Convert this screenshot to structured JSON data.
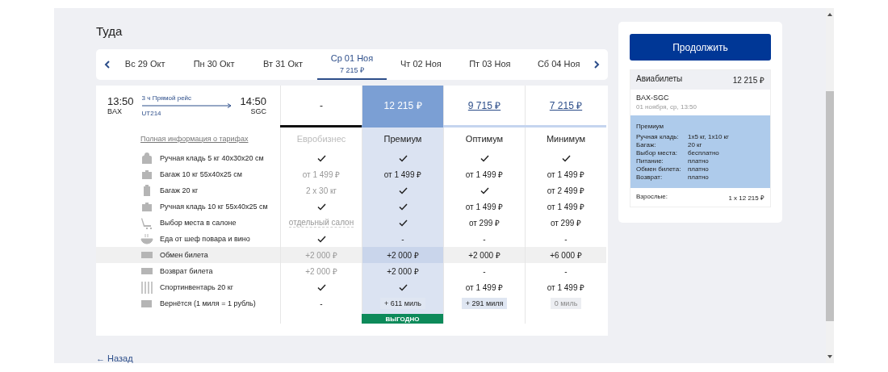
{
  "direction_title": "Туда",
  "dates": [
    {
      "label": "Вс 29 Окт",
      "selected": false
    },
    {
      "label": "Пн 30 Окт",
      "selected": false
    },
    {
      "label": "Вт 31 Окт",
      "selected": false
    },
    {
      "label": "Ср 01 Ноя",
      "price": "7 215 ₽",
      "selected": true
    },
    {
      "label": "Чт 02 Ноя",
      "selected": false
    },
    {
      "label": "Пт 03 Ноя",
      "selected": false
    },
    {
      "label": "Сб 04 Ноя",
      "selected": false
    }
  ],
  "flight": {
    "depart_time": "13:50",
    "depart_airport": "BAX",
    "duration": "3 ч",
    "flight_type": "Прямой рейс",
    "flight_number": "UT214",
    "arrive_time": "14:50",
    "arrive_airport": "SGC"
  },
  "fare_info_link": "Полная информация о тарифах",
  "tariffs": [
    {
      "name": "Евробизнес",
      "price": "-",
      "available": false,
      "selected": false
    },
    {
      "name": "Премиум",
      "price": "12 215 ₽",
      "available": true,
      "selected": true
    },
    {
      "name": "Оптимум",
      "price": "9 715 ₽",
      "available": true,
      "selected": false
    },
    {
      "name": "Минимум",
      "price": "7 215 ₽",
      "available": true,
      "selected": false
    }
  ],
  "features": [
    {
      "label": "Ручная кладь 5 кг 40x30x20 см",
      "highlighted": false,
      "values": [
        {
          "kind": "check"
        },
        {
          "kind": "check"
        },
        {
          "kind": "check"
        },
        {
          "kind": "check"
        }
      ]
    },
    {
      "label": "Багаж 10 кг 55x40x25 см",
      "highlighted": false,
      "values": [
        {
          "kind": "text",
          "text": "от 1 499 ₽",
          "muted": true
        },
        {
          "kind": "text",
          "text": "от 1 499 ₽",
          "muted": false
        },
        {
          "kind": "text",
          "text": "от 1 499 ₽",
          "muted": false
        },
        {
          "kind": "text",
          "text": "от 1 499 ₽",
          "muted": false
        }
      ]
    },
    {
      "label": "Багаж 20 кг",
      "highlighted": false,
      "values": [
        {
          "kind": "text",
          "text": "2 x 30 кг",
          "muted": true
        },
        {
          "kind": "check"
        },
        {
          "kind": "check"
        },
        {
          "kind": "text",
          "text": "от 2 499 ₽",
          "muted": false
        }
      ]
    },
    {
      "label": "Ручная кладь 10 кг 55x40x25 см",
      "highlighted": false,
      "values": [
        {
          "kind": "check"
        },
        {
          "kind": "check"
        },
        {
          "kind": "text",
          "text": "от 1 499 ₽",
          "muted": false
        },
        {
          "kind": "text",
          "text": "от 1 499 ₽",
          "muted": false
        }
      ]
    },
    {
      "label": "Выбор места в салоне",
      "highlighted": false,
      "values": [
        {
          "kind": "link",
          "text": "отдельный салон",
          "muted": true
        },
        {
          "kind": "check"
        },
        {
          "kind": "text",
          "text": "от 299 ₽",
          "muted": false
        },
        {
          "kind": "text",
          "text": "от 299 ₽",
          "muted": false
        }
      ]
    },
    {
      "label": "Еда от шеф повара и вино",
      "highlighted": false,
      "values": [
        {
          "kind": "check"
        },
        {
          "kind": "text",
          "text": "-",
          "muted": false
        },
        {
          "kind": "text",
          "text": "-",
          "muted": false
        },
        {
          "kind": "text",
          "text": "-",
          "muted": false
        }
      ]
    },
    {
      "label": "Обмен билета",
      "highlighted": true,
      "values": [
        {
          "kind": "text",
          "text": "+2 000 ₽",
          "muted": true
        },
        {
          "kind": "text",
          "text": "+2 000 ₽",
          "muted": false
        },
        {
          "kind": "text",
          "text": "+2 000 ₽",
          "muted": false
        },
        {
          "kind": "text",
          "text": "+6 000 ₽",
          "muted": false
        }
      ]
    },
    {
      "label": "Возврат билета",
      "highlighted": false,
      "values": [
        {
          "kind": "text",
          "text": "+2 000 ₽",
          "muted": true
        },
        {
          "kind": "text",
          "text": "+2 000 ₽",
          "muted": false
        },
        {
          "kind": "text",
          "text": "-",
          "muted": false
        },
        {
          "kind": "text",
          "text": "-",
          "muted": false
        }
      ]
    },
    {
      "label": "Спортинвентарь 20 кг",
      "highlighted": false,
      "values": [
        {
          "kind": "check"
        },
        {
          "kind": "check"
        },
        {
          "kind": "text",
          "text": "от 1 499 ₽",
          "muted": false
        },
        {
          "kind": "text",
          "text": "от 1 499 ₽",
          "muted": false
        }
      ]
    },
    {
      "label": "Вернётся (1 миля = 1 рубль)",
      "highlighted": false,
      "values": [
        {
          "kind": "text",
          "text": "-",
          "muted": false
        },
        {
          "kind": "badge",
          "text": "+ 611 миль",
          "muted": false
        },
        {
          "kind": "badge",
          "text": "+ 291 миля",
          "muted": false
        },
        {
          "kind": "badge",
          "text": "0 миль",
          "muted": true
        }
      ]
    }
  ],
  "best_badge": "ВЫГОДНО",
  "back_link": "← Назад",
  "summary": {
    "continue_button": "Продолжить",
    "tickets_label": "Авиабилеты",
    "tickets_total": "12 215 ₽",
    "route": "BAX-SGC",
    "date": "01 ноября, ср, 13:50",
    "tariff_name": "Премиум",
    "details": [
      {
        "label": "Ручная кладь:",
        "value": "1x5 кг, 1x10 кг"
      },
      {
        "label": "Багаж:",
        "value": "20 кг"
      },
      {
        "label": "Выбор места:",
        "value": "бесплатно"
      },
      {
        "label": "Питание:",
        "value": "платно"
      },
      {
        "label": "Обмен билета:",
        "value": "платно"
      },
      {
        "label": "Возврат:",
        "value": "платно"
      }
    ],
    "passengers_label": "Взрослые:",
    "passengers_value": "1 x 12 215 ₽"
  }
}
